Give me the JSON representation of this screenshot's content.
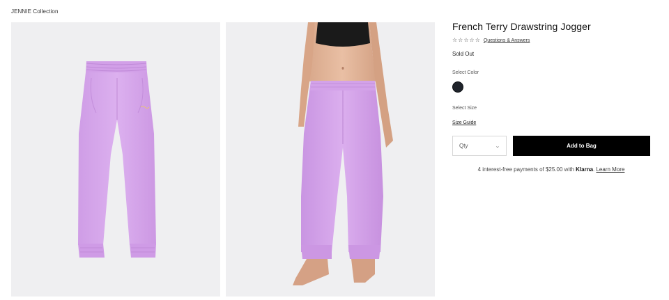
{
  "breadcrumb": "JENNIE Collection",
  "product": {
    "title": "French Terry Drawstring Jogger",
    "stars": [
      "☆",
      "☆",
      "☆",
      "☆",
      "☆"
    ],
    "qa_link": "Questions & Answers",
    "status": "Sold Out",
    "color_label": "Select Color",
    "color_swatch": "#1f232b",
    "size_label": "Select Size",
    "size_guide": "Size Guide"
  },
  "purchase": {
    "qty_label": "Qty",
    "qty_icon": "chevron-down-icon",
    "add_to_bag": "Add to Bag"
  },
  "klarna": {
    "prefix": "4 interest-free payments of $25.00 with ",
    "brand": "Klarna",
    "suffix": ". ",
    "learn_more": "Learn More"
  },
  "colors": {
    "product_lilac": "#d7a8ec",
    "panel_bg": "#efeff1",
    "button_bg": "#000000"
  }
}
